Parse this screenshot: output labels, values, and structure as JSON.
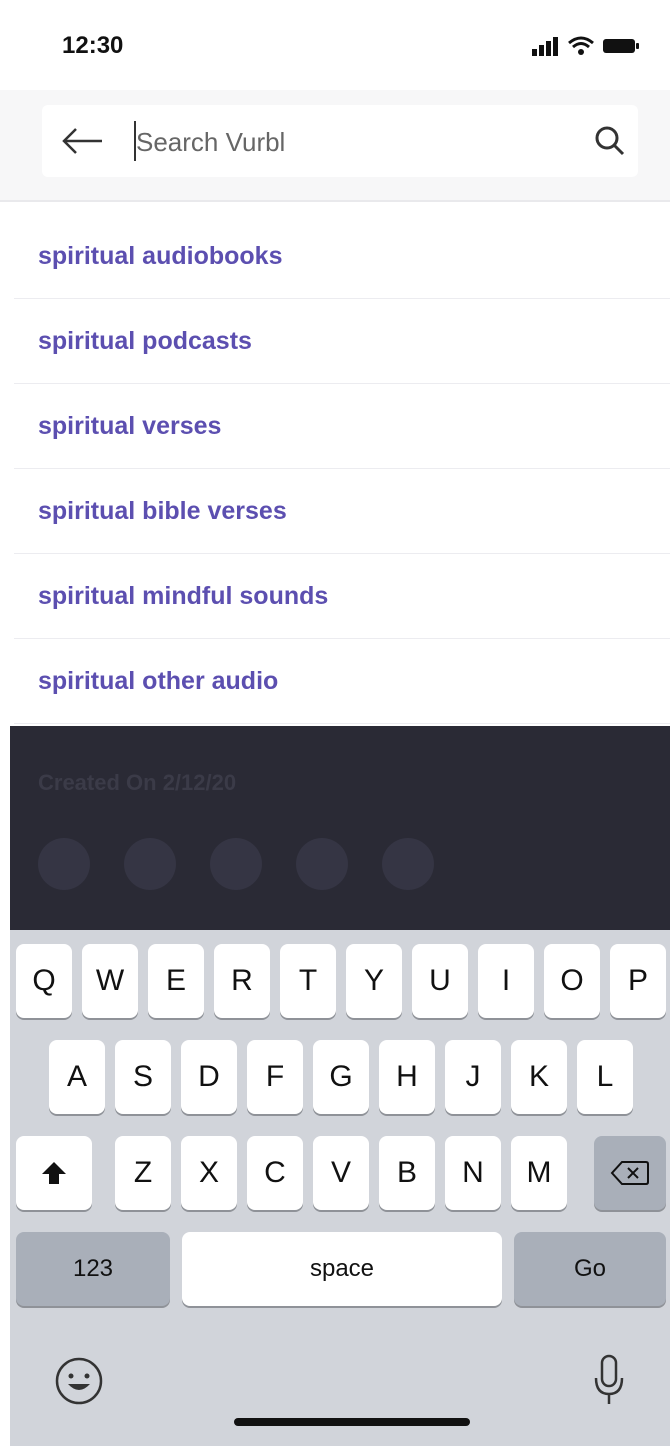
{
  "status_bar": {
    "time": "12:30"
  },
  "search": {
    "placeholder": "Search Vurbl",
    "value": ""
  },
  "suggestions": [
    "spiritual audiobooks",
    "spiritual podcasts",
    "spiritual verses",
    "spiritual bible verses",
    "spiritual mindful sounds",
    "spiritual other audio"
  ],
  "background_content": {
    "date_label": "Created On 2/12/20"
  },
  "keyboard": {
    "row1": [
      "Q",
      "W",
      "E",
      "R",
      "T",
      "Y",
      "U",
      "I",
      "O",
      "P"
    ],
    "row2": [
      "A",
      "S",
      "D",
      "F",
      "G",
      "H",
      "J",
      "K",
      "L"
    ],
    "row3": [
      "Z",
      "X",
      "C",
      "V",
      "B",
      "N",
      "M"
    ],
    "numbers_label": "123",
    "space_label": "space",
    "go_label": "Go"
  },
  "colors": {
    "accent": "#5c4fb0",
    "overlay": "#2a2a35",
    "keyboard_bg": "#d1d4da"
  }
}
